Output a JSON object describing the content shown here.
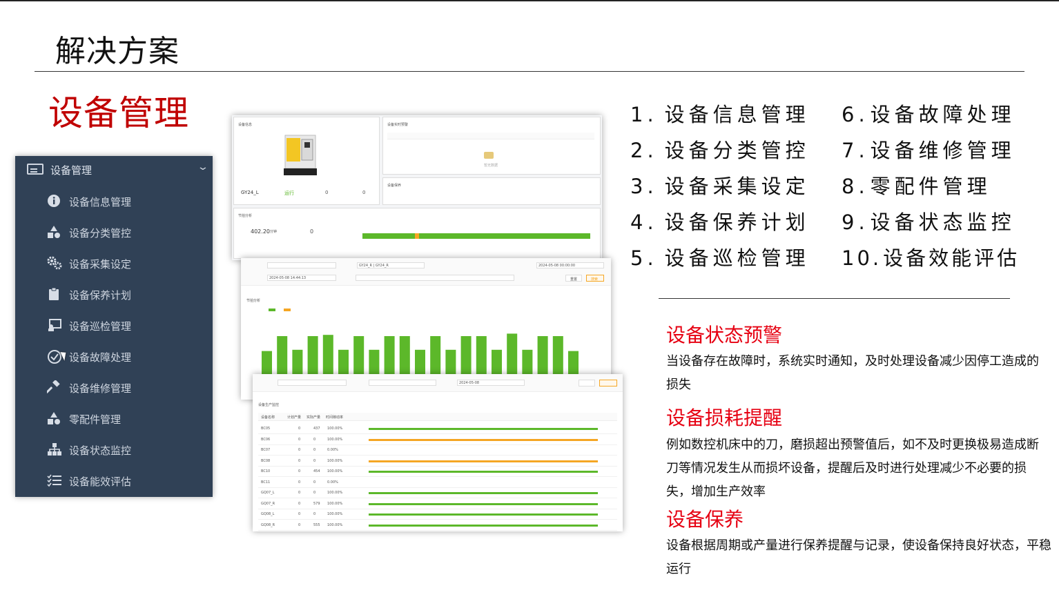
{
  "slide": {
    "title": "解决方案",
    "subtitle": "设备管理"
  },
  "sidebar": {
    "header": "设备管理",
    "items": [
      {
        "label": "设备信息管理",
        "icon": "info-icon"
      },
      {
        "label": "设备分类管控",
        "icon": "shapes-icon"
      },
      {
        "label": "设备采集设定",
        "icon": "gears-icon"
      },
      {
        "label": "设备保养计划",
        "icon": "clipboard-icon"
      },
      {
        "label": "设备巡检管理",
        "icon": "inspection-icon"
      },
      {
        "label": "设备故障处理",
        "icon": "check-circle-icon"
      },
      {
        "label": "设备维修管理",
        "icon": "hammer-icon"
      },
      {
        "label": "零配件管理",
        "icon": "shapes-icon"
      },
      {
        "label": "设备状态监控",
        "icon": "sitemap-icon"
      },
      {
        "label": "设备能效评估",
        "icon": "list-check-icon"
      }
    ]
  },
  "features": [
    {
      "num": "1.",
      "label": "设备信息管理"
    },
    {
      "num": "2.",
      "label": "设备分类管控"
    },
    {
      "num": "3.",
      "label": "设备采集设定"
    },
    {
      "num": "4.",
      "label": "设备保养计划"
    },
    {
      "num": "5.",
      "label": "设备巡检管理"
    },
    {
      "num": "6.",
      "label": "设备故障处理"
    },
    {
      "num": "7.",
      "label": "设备维修管理"
    },
    {
      "num": "8.",
      "label": "零配件管理"
    },
    {
      "num": "9.",
      "label": "设备状态监控"
    },
    {
      "num": "10.",
      "label": "设备效能评估"
    }
  ],
  "sections": [
    {
      "title": "设备状态预警",
      "text": "当设备存在故障时，系统实时通知，及时处理设备减少因停工造成的损失"
    },
    {
      "title": "设备损耗提醒",
      "text": "例如数控机床中的刀，磨损超出预警值后，如不及时更换极易造成断刀等情况发生从而损坏设备，提醒后及时进行处理减少不必要的损失，增加生产效率"
    },
    {
      "title": "设备保养",
      "text": "设备根据周期或产量进行保养提醒与记录，使设备保持良好状态，平稳运行"
    }
  ],
  "shot1": {
    "info_title": "设备信息",
    "machine": "GY24_L",
    "status": "运行",
    "plan": "0",
    "produced": "0",
    "runtime": "402.20",
    "unit": "分钟",
    "zero": "0",
    "realtime_title": "设备实时预警",
    "maintain_title": "设备保养",
    "beat_title": "节拍分析",
    "nodata": "暂无数据"
  },
  "shot2": {
    "filter_date": "2024-05-08 14:44:13",
    "device": "GY24_R | GY24_R",
    "start": "2024-05-08 00:00:00",
    "beat_title": "节拍分析",
    "reset": "重置",
    "search": "搜索"
  },
  "shot3": {
    "date": "2024-05-08",
    "title": "设备生产监控",
    "headers": [
      "设备名称",
      "计划产量",
      "实际产量",
      "时间稼动率"
    ],
    "rows": [
      {
        "name": "BC05",
        "plan": "0",
        "actual": "437",
        "rate": "100.00%"
      },
      {
        "name": "BC06",
        "plan": "0",
        "actual": "0",
        "rate": "100.00%"
      },
      {
        "name": "BC07",
        "plan": "0",
        "actual": "0",
        "rate": "0.00%"
      },
      {
        "name": "BC08",
        "plan": "0",
        "actual": "0",
        "rate": "100.00%"
      },
      {
        "name": "BC10",
        "plan": "0",
        "actual": "454",
        "rate": "100.00%"
      },
      {
        "name": "BC11",
        "plan": "0",
        "actual": "0",
        "rate": "0.00%"
      },
      {
        "name": "GQ07_L",
        "plan": "0",
        "actual": "0",
        "rate": "100.00%"
      },
      {
        "name": "GQ07_R",
        "plan": "0",
        "actual": "579",
        "rate": "100.00%"
      },
      {
        "name": "GQ08_L",
        "plan": "0",
        "actual": "0",
        "rate": "100.00%"
      },
      {
        "name": "GQ08_R",
        "plan": "0",
        "actual": "555",
        "rate": "100.00%"
      }
    ]
  },
  "colors": {
    "accent_red": "#e60012",
    "title_red": "#c00000",
    "sidebar_bg": "#304156",
    "run_green": "#5cb82a",
    "idle_orange": "#f5a623",
    "stop_purple": "#8e24aa"
  }
}
